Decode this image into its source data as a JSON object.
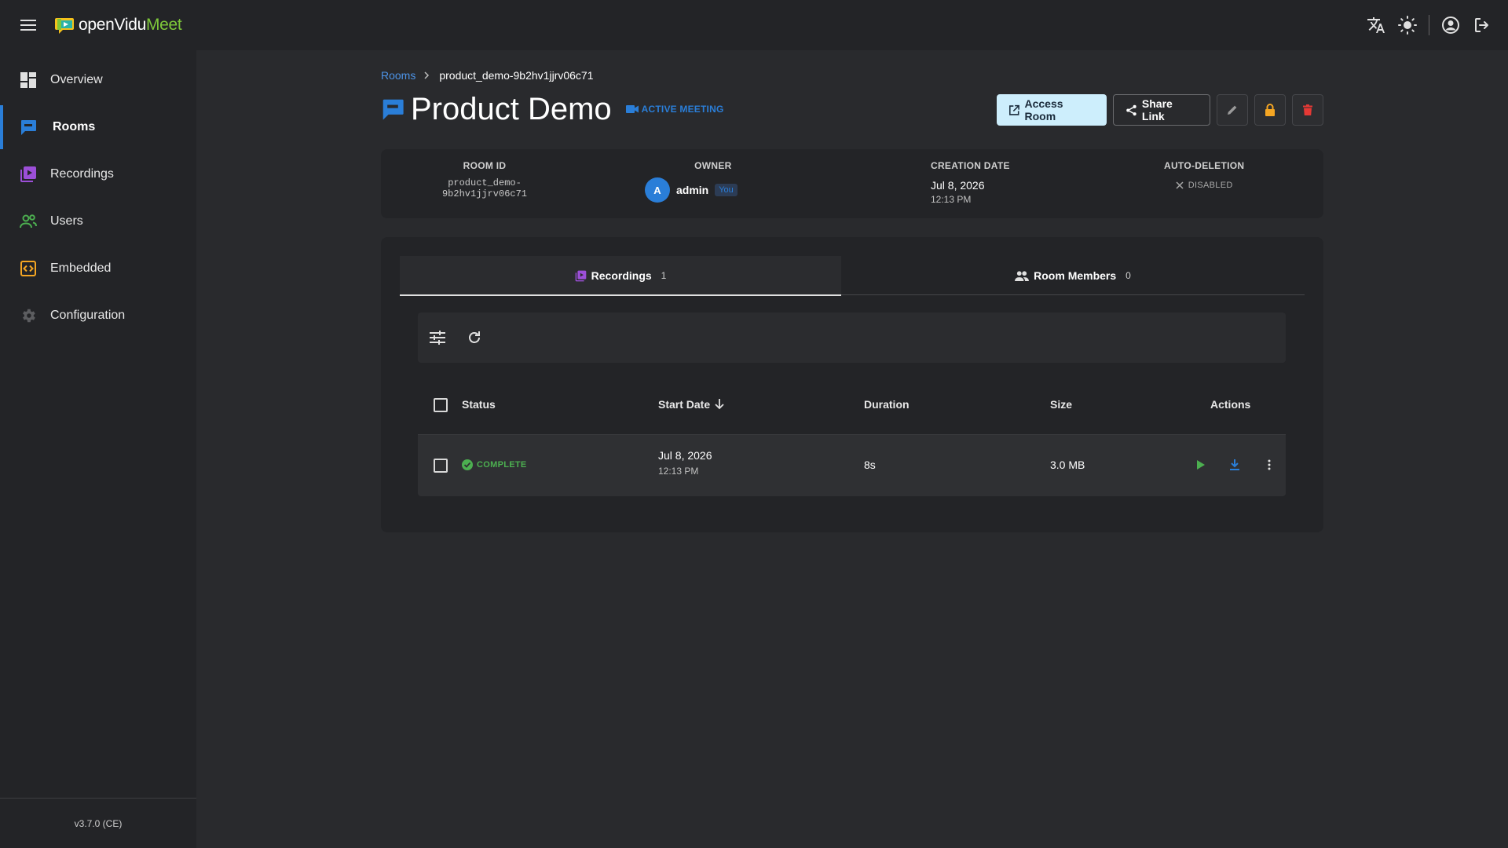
{
  "app": {
    "logo_open": "openVidu",
    "logo_meet": "Meet",
    "version": "v3.7.0 (CE)"
  },
  "sidebar": {
    "items": [
      {
        "label": "Overview",
        "icon": "dashboard-icon"
      },
      {
        "label": "Rooms",
        "icon": "chat-icon",
        "active": true
      },
      {
        "label": "Recordings",
        "icon": "video-library-icon"
      },
      {
        "label": "Users",
        "icon": "users-icon"
      },
      {
        "label": "Embedded",
        "icon": "code-icon"
      },
      {
        "label": "Configuration",
        "icon": "gear-icon"
      }
    ]
  },
  "breadcrumb": {
    "root": "Rooms",
    "current": "product_demo-9b2hv1jjrv06c71"
  },
  "header": {
    "title": "Product Demo",
    "status_badge": "ACTIVE MEETING",
    "access_room": "Access Room",
    "share_link": "Share Link"
  },
  "info": {
    "room_id_label": "ROOM ID",
    "room_id": "product_demo-9b2hv1jjrv06c71",
    "owner_label": "OWNER",
    "owner_initial": "A",
    "owner_name": "admin",
    "owner_you": "You",
    "creation_label": "CREATION DATE",
    "creation_date": "Jul 8, 2026",
    "creation_time": "12:13 PM",
    "autodel_label": "AUTO-DELETION",
    "autodel_value": "DISABLED"
  },
  "tabs": {
    "recordings_label": "Recordings",
    "recordings_count": "1",
    "members_label": "Room Members",
    "members_count": "0"
  },
  "table": {
    "headers": {
      "status": "Status",
      "start_date": "Start Date",
      "duration": "Duration",
      "size": "Size",
      "actions": "Actions"
    },
    "rows": [
      {
        "status": "COMPLETE",
        "date": "Jul 8, 2026",
        "time": "12:13 PM",
        "duration": "8s",
        "size": "3.0 MB"
      }
    ]
  },
  "colors": {
    "accent": "#2a7ed8",
    "success": "#4caf50",
    "warning": "#f5a623",
    "danger": "#e53935",
    "recordings": "#9c4fd8",
    "users": "#4caf50",
    "embedded": "#f5a623"
  }
}
